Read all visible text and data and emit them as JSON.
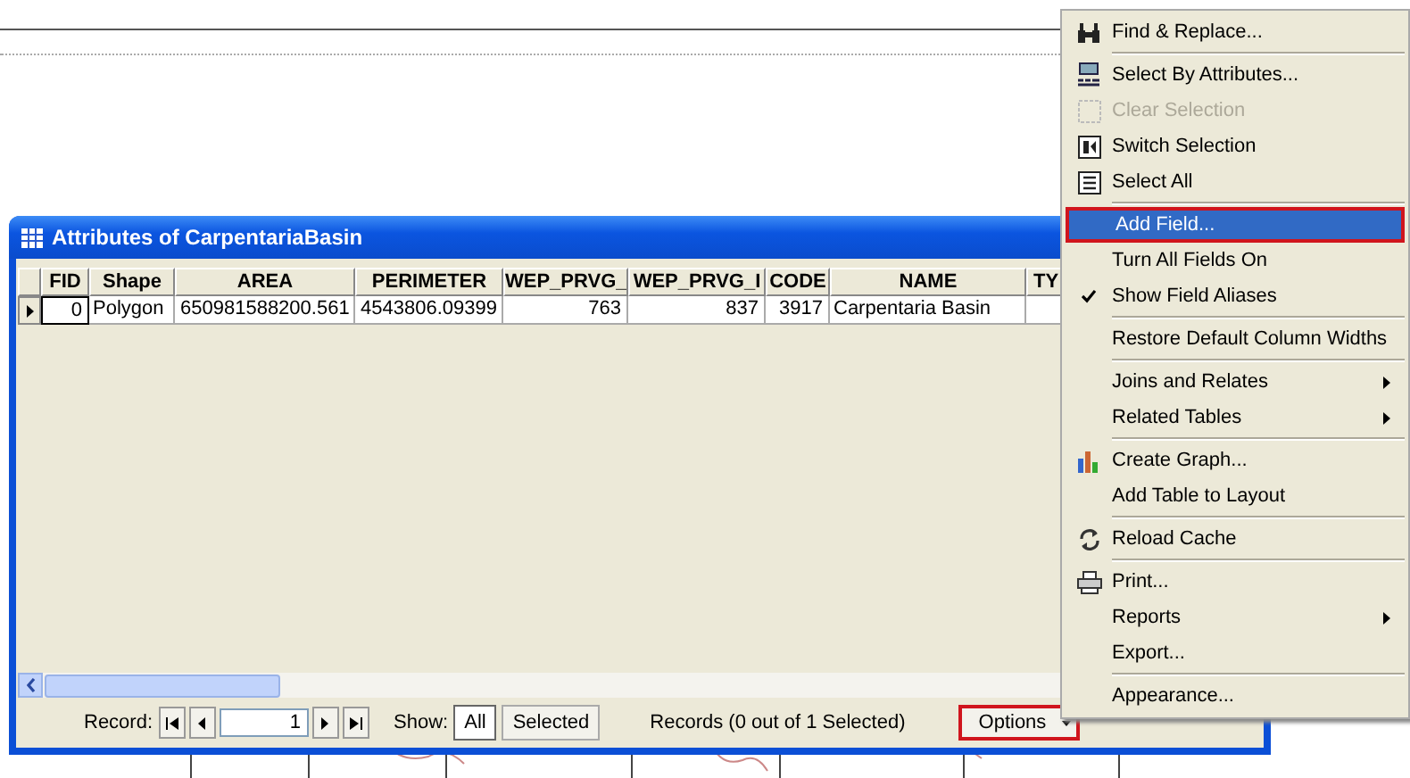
{
  "window": {
    "title": "Attributes of CarpentariaBasin"
  },
  "table": {
    "columns": [
      "FID",
      "Shape",
      "AREA",
      "PERIMETER",
      "WEP_PRVG_",
      "WEP_PRVG_I",
      "CODE",
      "NAME",
      "TY"
    ],
    "rows": [
      {
        "selected": false,
        "cells": [
          "0",
          "Polygon",
          "650981588200.561",
          "4543806.09399",
          "763",
          "837",
          "3917",
          "Carpentaria Basin",
          ""
        ]
      }
    ]
  },
  "footer": {
    "record_label": "Record:",
    "record_value": "1",
    "show_label": "Show:",
    "show_options": [
      {
        "label": "All",
        "selected": true
      },
      {
        "label": "Selected",
        "selected": false
      }
    ],
    "records_text": "Records (0 out of 1 Selected)",
    "options_button": {
      "label": "Options",
      "annotated": true
    }
  },
  "menu": {
    "groups": [
      [
        {
          "label": "Find & Replace...",
          "disabled": false,
          "selected": false,
          "checked": false,
          "submenu": false,
          "annotated": false
        }
      ],
      [
        {
          "label": "Select By Attributes...",
          "disabled": false,
          "selected": false,
          "checked": false,
          "submenu": false,
          "annotated": false
        },
        {
          "label": "Clear Selection",
          "disabled": true,
          "selected": false,
          "checked": false,
          "submenu": false,
          "annotated": false
        },
        {
          "label": "Switch Selection",
          "disabled": false,
          "selected": false,
          "checked": false,
          "submenu": false,
          "annotated": false
        },
        {
          "label": "Select All",
          "disabled": false,
          "selected": false,
          "checked": false,
          "submenu": false,
          "annotated": false
        }
      ],
      [
        {
          "label": "Add Field...",
          "disabled": false,
          "selected": true,
          "checked": false,
          "submenu": false,
          "annotated": true
        },
        {
          "label": "Turn All Fields On",
          "disabled": false,
          "selected": false,
          "checked": false,
          "submenu": false,
          "annotated": false
        },
        {
          "label": "Show Field Aliases",
          "disabled": false,
          "selected": false,
          "checked": true,
          "submenu": false,
          "annotated": false
        }
      ],
      [
        {
          "label": "Restore Default Column Widths",
          "disabled": false,
          "selected": false,
          "checked": false,
          "submenu": false,
          "annotated": false
        }
      ],
      [
        {
          "label": "Joins and Relates",
          "disabled": false,
          "selected": false,
          "checked": false,
          "submenu": true,
          "annotated": false
        },
        {
          "label": "Related Tables",
          "disabled": false,
          "selected": false,
          "checked": false,
          "submenu": true,
          "annotated": false
        }
      ],
      [
        {
          "label": "Create Graph...",
          "disabled": false,
          "selected": false,
          "checked": false,
          "submenu": false,
          "annotated": false
        },
        {
          "label": "Add Table to Layout",
          "disabled": false,
          "selected": false,
          "checked": false,
          "submenu": false,
          "annotated": false
        }
      ],
      [
        {
          "label": "Reload Cache",
          "disabled": false,
          "selected": false,
          "checked": false,
          "submenu": false,
          "annotated": false
        }
      ],
      [
        {
          "label": "Print...",
          "disabled": false,
          "selected": false,
          "checked": false,
          "submenu": false,
          "annotated": false
        },
        {
          "label": "Reports",
          "disabled": false,
          "selected": false,
          "checked": false,
          "submenu": true,
          "annotated": false
        },
        {
          "label": "Export...",
          "disabled": false,
          "selected": false,
          "checked": false,
          "submenu": false,
          "annotated": false
        }
      ],
      [
        {
          "label": "Appearance...",
          "disabled": false,
          "selected": false,
          "checked": false,
          "submenu": false,
          "annotated": false
        }
      ]
    ]
  }
}
